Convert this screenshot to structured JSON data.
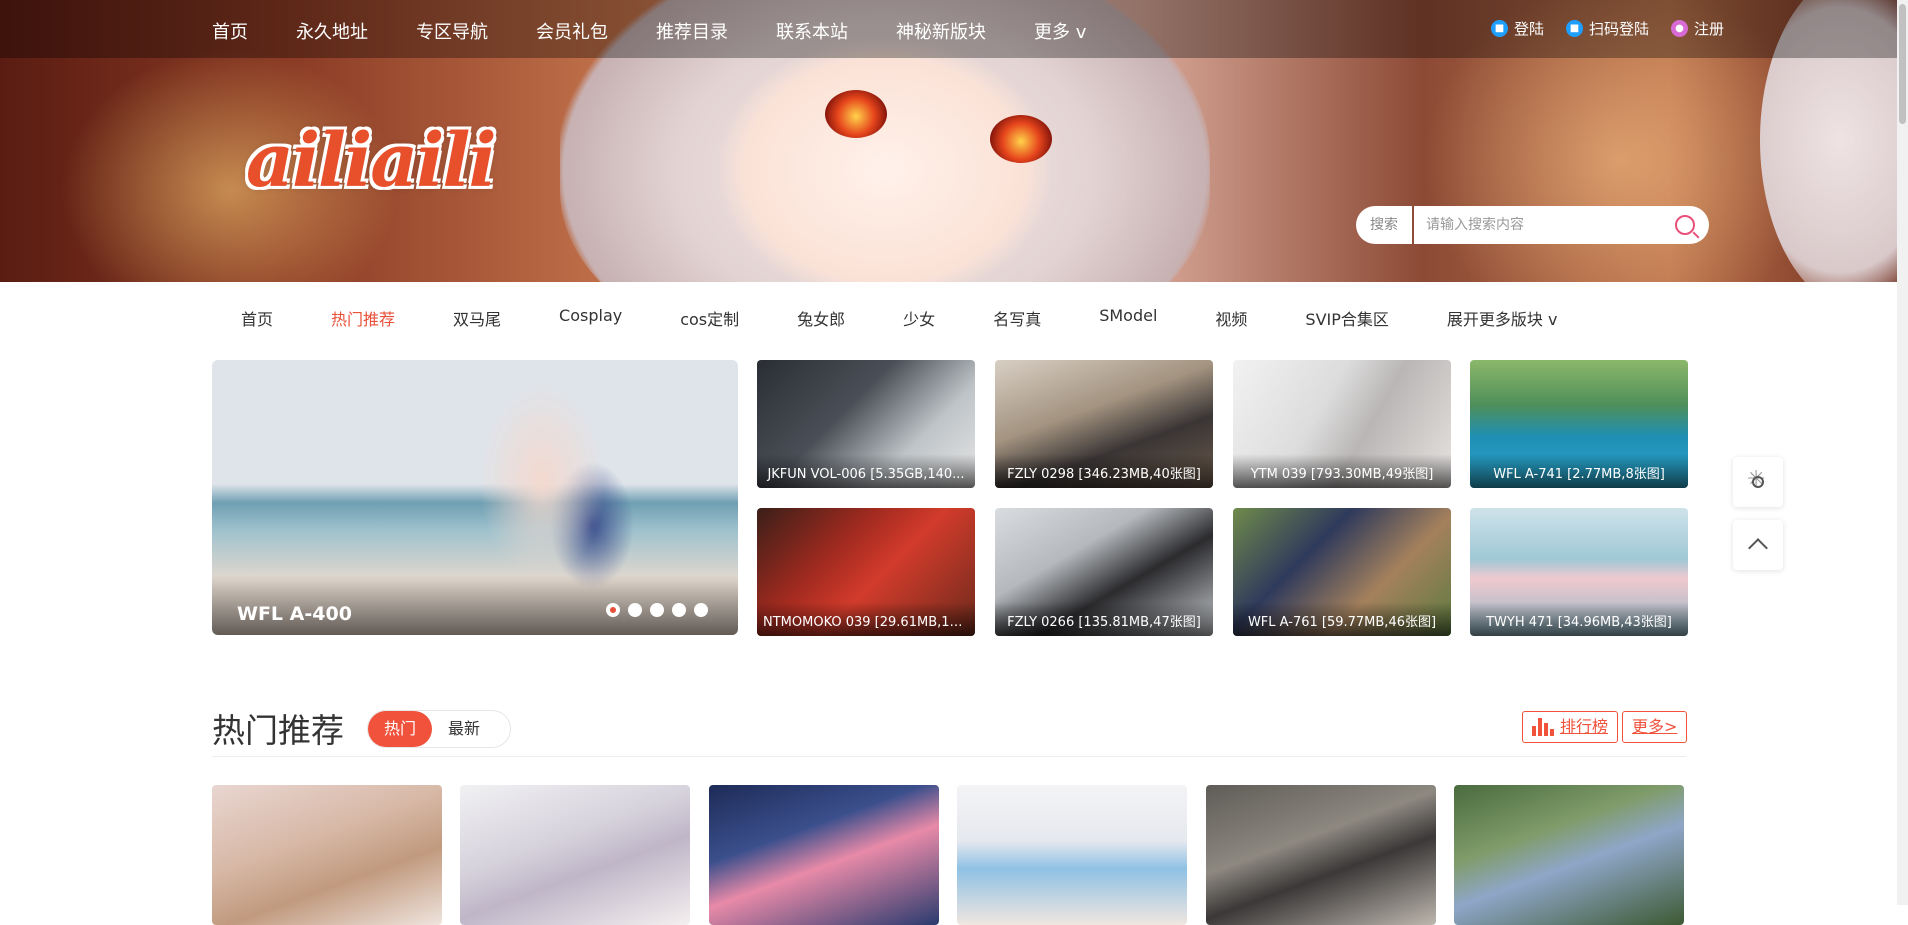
{
  "header": {
    "logo": "ailiaili",
    "nav": [
      "首页",
      "永久地址",
      "专区导航",
      "会员礼包",
      "推荐目录",
      "联系本站",
      "神秘新版块",
      "更多 v"
    ],
    "auth": {
      "login": "登陆",
      "qr_login": "扫码登陆",
      "register": "注册"
    },
    "search": {
      "tag": "搜索",
      "placeholder": "请输入搜索内容"
    }
  },
  "subnav": {
    "items": [
      "首页",
      "热门推荐",
      "双马尾",
      "Cosplay",
      "cos定制",
      "兔女郎",
      "少女",
      "名写真",
      "SModel",
      "视频",
      "SVIP合集区",
      "展开更多版块 v"
    ],
    "active_index": 1
  },
  "featured": {
    "slider": {
      "title": "WFL A-400",
      "slides": 5,
      "active": 0
    },
    "thumbs": [
      "JKFUN VOL-006 [5.35GB,140...",
      "FZLY 0298 [346.23MB,40张图]",
      "YTM 039 [793.30MB,49张图]",
      "WFL A-741 [2.77MB,8张图]",
      "NTMOMOKO 039 [29.61MB,13...",
      "FZLY 0266 [135.81MB,47张图]",
      "WFL A-761 [59.77MB,46张图]",
      "TWYH 471 [34.96MB,43张图]"
    ]
  },
  "section": {
    "title": "热门推荐",
    "tabs": [
      "热门",
      "最新"
    ],
    "active_tab": 0,
    "rank_label": "排行榜",
    "more_label": "更多>"
  },
  "icons": {
    "theme_toggle": "sun-icon",
    "back_to_top": "chevron-up-icon"
  },
  "colors": {
    "accent": "#f0523c",
    "search_accent": "#e8507a",
    "auth_icon": "#1e9fff"
  }
}
